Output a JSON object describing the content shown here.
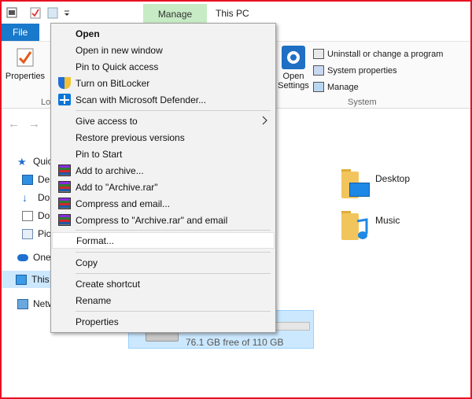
{
  "titlebar": {
    "manage_tab": "Manage",
    "window_title": "This PC"
  },
  "ribbon": {
    "file_tab": "File",
    "properties_label": "Properties",
    "location_group_label": "Lo",
    "open_settings_label": "Open Settings",
    "system_items": [
      "Uninstall or change a program",
      "System properties",
      "Manage"
    ],
    "system_group_label": "System"
  },
  "nav_pane": {
    "items": [
      {
        "label": "Quic",
        "icon": "star-icon"
      },
      {
        "label": "Des",
        "icon": "desktop-icon"
      },
      {
        "label": "Do",
        "icon": "download-icon"
      },
      {
        "label": "Do",
        "icon": "document-icon"
      },
      {
        "label": "Pic",
        "icon": "pictures-icon"
      },
      {
        "label": "One",
        "icon": "cloud-icon"
      },
      {
        "label": "This",
        "icon": "pc-icon",
        "selected": true
      },
      {
        "label": "Netw",
        "icon": "network-icon"
      }
    ]
  },
  "content": {
    "folders": [
      {
        "label": "Desktop",
        "icon": "desktop-folder-icon"
      },
      {
        "label": "Music",
        "icon": "music-folder-icon"
      }
    ],
    "drive": {
      "free_text": "76.1 GB free of 110 GB",
      "used_fraction": 0.31
    }
  },
  "context_menu": {
    "items": [
      {
        "label": "Open",
        "bold": true
      },
      {
        "label": "Open in new window"
      },
      {
        "label": "Pin to Quick access"
      },
      {
        "label": "Turn on BitLocker",
        "icon": "shield-icon"
      },
      {
        "label": "Scan with Microsoft Defender...",
        "icon": "defender-icon"
      },
      {
        "label": "Give access to",
        "submenu": true
      },
      {
        "label": "Restore previous versions"
      },
      {
        "label": "Pin to Start"
      },
      {
        "label": "Add to archive...",
        "icon": "winrar-icon"
      },
      {
        "label": "Add to \"Archive.rar\"",
        "icon": "winrar-icon"
      },
      {
        "label": "Compress and email...",
        "icon": "winrar-icon"
      },
      {
        "label": "Compress to \"Archive.rar\" and email",
        "icon": "winrar-icon"
      },
      {
        "label": "Format...",
        "hover": true
      },
      {
        "label": "Copy"
      },
      {
        "label": "Create shortcut"
      },
      {
        "label": "Rename"
      },
      {
        "label": "Properties"
      }
    ]
  },
  "colors": {
    "accent": "#1979ca",
    "manage_tab": "#c7ebc4",
    "frame_border": "#e81123",
    "selection": "#cce8ff"
  }
}
